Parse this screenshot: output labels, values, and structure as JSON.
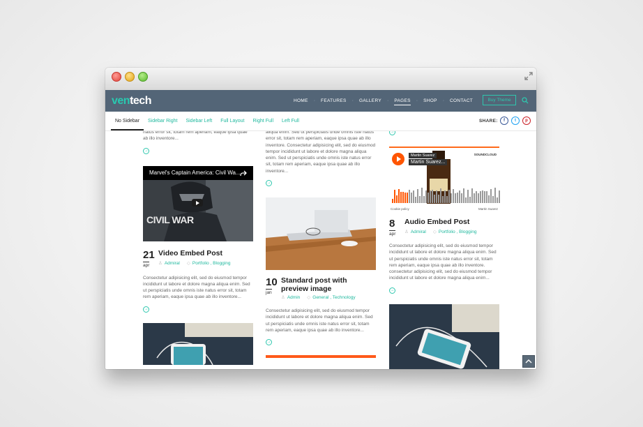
{
  "brand": {
    "logo_part1": "ven",
    "logo_part2": "tech",
    "accent": "#2ec7ae",
    "nav_bg": "#536577"
  },
  "nav": {
    "items": [
      {
        "label": "HOME",
        "active": false
      },
      {
        "label": "FEATURES",
        "active": false
      },
      {
        "label": "GALLERY",
        "active": false
      },
      {
        "label": "PAGES",
        "active": true
      },
      {
        "label": "SHOP",
        "active": false
      },
      {
        "label": "CONTACT",
        "active": false
      }
    ],
    "separator": "·",
    "buy_button": "Buy Theme",
    "search_icon": "search-icon"
  },
  "subnav": {
    "tabs": [
      {
        "label": "No Sidebar",
        "active": true
      },
      {
        "label": "Sidebar Right",
        "active": false
      },
      {
        "label": "Sidebar Left",
        "active": false
      },
      {
        "label": "Full Layout",
        "active": false
      },
      {
        "label": "Right Full",
        "active": false
      },
      {
        "label": "Left Full",
        "active": false
      }
    ],
    "share_label": "SHARE:",
    "share_icons": [
      "facebook-icon",
      "twitter-icon",
      "pinterest-icon"
    ],
    "share_glyphs": {
      "facebook": "f",
      "twitter": "t",
      "pinterest": "p"
    }
  },
  "posts": {
    "left_top_excerpt": "natus error sit, totam rem aperiam, eaque ipsa quae ab illo inventore...",
    "video": {
      "video_title": "Marvel's Captain America: Civil Wa...",
      "poster_text": "CIVIL WAR",
      "day": "21",
      "month": "apr",
      "title": "Video Embed Post",
      "author": "Admiral",
      "categories": "Portfolio , Blogging",
      "excerpt": "Consectetur adipisicing elit, sed do eiusmod tempor incididunt ut labore et dolore magna aliqua enim. Sed ut perspiciatis unde omnis iste natus error sit, totam rem aperiam, eaque ipsa quae ab illo inventore..."
    },
    "middle_top_excerpt": "aliqua enim. Sed ut perspiciatis unde omnis iste natus error sit, totam rem aperiam, eaque ipsa quae ab illo inventore. Consectetur adipisicing elit, sed do eiusmod tempor incididunt ut labore et dolore magna aliqua enim. Sed ut perspiciatis unde omnis iste natus error sit, totam rem aperiam, eaque ipsa quae ab illo inventore...",
    "standard": {
      "day": "10",
      "month": "jan",
      "title_line1": "Standard post with",
      "title_line2": "preview image",
      "author": "Admin",
      "categories": "General , Technology",
      "excerpt": "Consectetur adipisicing elit, sed do eiusmod tempor incididunt ut labore et dolore magna aliqua enim. Sed ut perspiciatis unde omnis iste natus error sit, totam rem aperiam, eaque ipsa quae ab illo inventore..."
    },
    "audio": {
      "sc_user": "Martin Suarez",
      "sc_track": "Martin Suarez...",
      "sc_logo": "SOUNDCLOUD",
      "sc_cookie": "Cookie policy",
      "sc_credit": "Martin Suarez",
      "day": "8",
      "month": "apr",
      "title": "Audio Embed Post",
      "author": "Admiral",
      "categories": "Portfolio , Blogging",
      "excerpt": "Consectetur adipisicing elit, sed do eiusmod tempor incididunt ut labore et dolore magna aliqua enim. Sed ut perspiciatis unde omnis iste natus error sit, totam rem aperiam, eaque ipsa quae ab illo inventore. consectetur adipisicing elit, sed do eiusmod tempor incididunt ut labore et dolore magna aliqua enim..."
    },
    "more_glyph": "→",
    "user_glyph": "♙",
    "tag_glyph": "◇"
  },
  "scroll_top_icon": "chevron-up-icon"
}
